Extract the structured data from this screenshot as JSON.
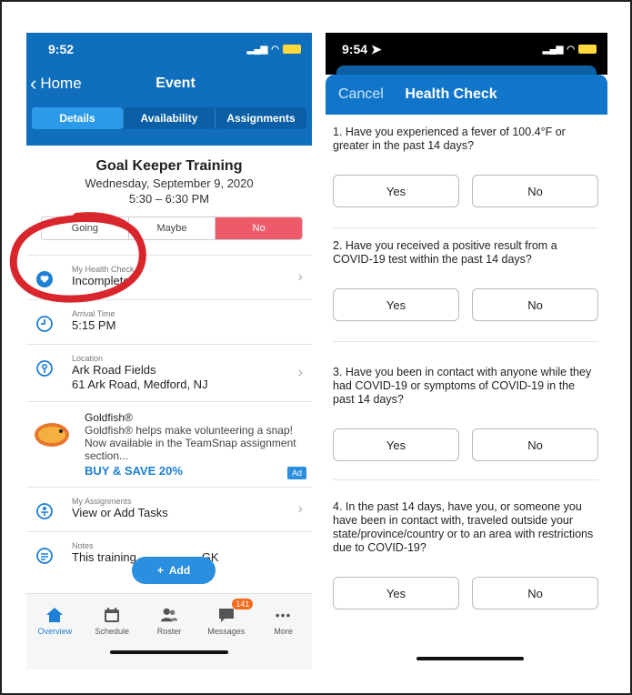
{
  "left": {
    "status_time": "9:52",
    "nav": {
      "back_label": "Home",
      "title": "Event"
    },
    "segments": [
      "Details",
      "Availability",
      "Assignments"
    ],
    "event": {
      "title": "Goal Keeper Training",
      "date": "Wednesday, September 9, 2020",
      "time": "5:30 – 6:30 PM"
    },
    "rsvp": [
      "Going",
      "Maybe",
      "No"
    ],
    "health_check": {
      "label": "My Health Check",
      "value": "Incomplete"
    },
    "arrival": {
      "label": "Arrival Time",
      "value": "5:15 PM"
    },
    "location": {
      "label": "Location",
      "name": "Ark Road Fields",
      "address": "61 Ark Road, Medford, NJ"
    },
    "ad": {
      "title": "Goldfish®",
      "body": "Goldfish® helps make volunteering a snap! Now available in the TeamSnap assignment section...",
      "cta": "BUY & SAVE 20%",
      "badge": "Ad",
      "logo_text": "Goldfish"
    },
    "assignments": {
      "label": "My Assignments",
      "value": "View or Add Tasks"
    },
    "notes": {
      "label": "Notes",
      "value_start": "This training",
      "value_end": "GK"
    },
    "fab_label": "Add",
    "tabs": [
      {
        "label": "Overview",
        "icon": "house-icon"
      },
      {
        "label": "Schedule",
        "icon": "calendar-icon"
      },
      {
        "label": "Roster",
        "icon": "people-icon"
      },
      {
        "label": "Messages",
        "icon": "chat-icon",
        "badge": "141"
      },
      {
        "label": "More",
        "icon": "ellipsis-icon"
      }
    ]
  },
  "right": {
    "status_time": "9:54",
    "nav": {
      "cancel_label": "Cancel",
      "title": "Health Check"
    },
    "questions": [
      {
        "text": "1. Have you experienced a fever of 100.4°F or greater in the past 14 days?",
        "yes": "Yes",
        "no": "No"
      },
      {
        "text": "2. Have you received a positive result from a COVID-19 test within the past 14 days?",
        "yes": "Yes",
        "no": "No"
      },
      {
        "text": "3. Have you been in contact with anyone while they had COVID-19 or symptoms of COVID-19 in the past 14 days?",
        "yes": "Yes",
        "no": "No"
      },
      {
        "text": "4. In the past 14 days, have you, or someone you have been in contact with, traveled outside your state/province/country or to an area with restrictions due to COVID-19?",
        "yes": "Yes",
        "no": "No"
      }
    ]
  },
  "colors": {
    "brand_blue": "#0f6fbd",
    "rsvp_no": "#ef5a6b",
    "annotation_red": "#d9262c",
    "badge_orange": "#f26a1a"
  }
}
